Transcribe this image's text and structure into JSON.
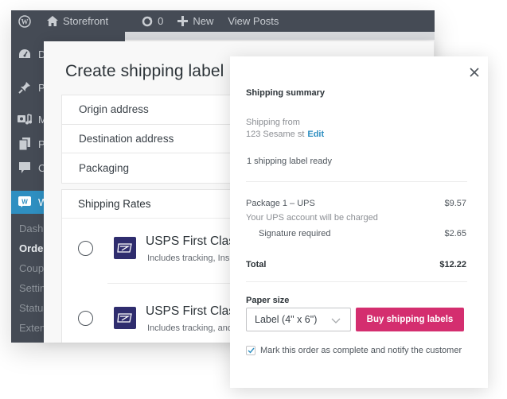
{
  "admin_bar": {
    "site_name": "Storefront",
    "updates_count": "0",
    "new_label": "New",
    "view_posts_label": "View Posts"
  },
  "sidebar": {
    "items": [
      {
        "label": "Dashboard",
        "icon": "dashboard-icon"
      },
      {
        "label": "Posts",
        "icon": "pin-icon"
      },
      {
        "label": "Media",
        "icon": "media-icon"
      },
      {
        "label": "Pages",
        "icon": "pages-icon"
      },
      {
        "label": "Comments",
        "icon": "comments-icon"
      },
      {
        "label": "WooCommerce",
        "icon": "woocommerce-icon",
        "active": true
      }
    ],
    "submenu": [
      {
        "label": "Dashboard"
      },
      {
        "label": "Orders",
        "current": true
      },
      {
        "label": "Coupons"
      },
      {
        "label": "Settings"
      },
      {
        "label": "Status"
      },
      {
        "label": "Extensions"
      }
    ]
  },
  "modal": {
    "title": "Create shipping label",
    "steps": [
      "Origin address",
      "Destination address",
      "Packaging"
    ],
    "rates_header": "Shipping Rates",
    "rates": [
      {
        "name": "USPS First Class",
        "description": "Includes tracking, Insurance",
        "selected": false
      },
      {
        "name": "USPS First Class",
        "description": "Includes tracking, and",
        "selected": false
      }
    ]
  },
  "summary": {
    "title": "Shipping summary",
    "shipping_from_label": "Shipping from",
    "address": "123 Sesame st",
    "edit_label": "Edit",
    "labels_ready": "1 shipping label ready",
    "package_label": "Package 1 – UPS",
    "package_amount": "$9.57",
    "account_note": "Your UPS account will be charged",
    "signature_label": "Signature required",
    "signature_amount": "$2.65",
    "total_label": "Total",
    "total_amount": "$12.22",
    "paper_size_label": "Paper size",
    "paper_size_value": "Label (4\" x 6\")",
    "buy_button": "Buy shipping labels",
    "mark_complete_label": "Mark this order as complete and notify the customer",
    "mark_complete_checked": true
  },
  "colors": {
    "admin_bar": "#454b55",
    "active_menu": "#2f8fc1",
    "buy_button": "#d42e6f",
    "usps_icon": "#2f2d6e",
    "link": "#2f8fc1"
  }
}
